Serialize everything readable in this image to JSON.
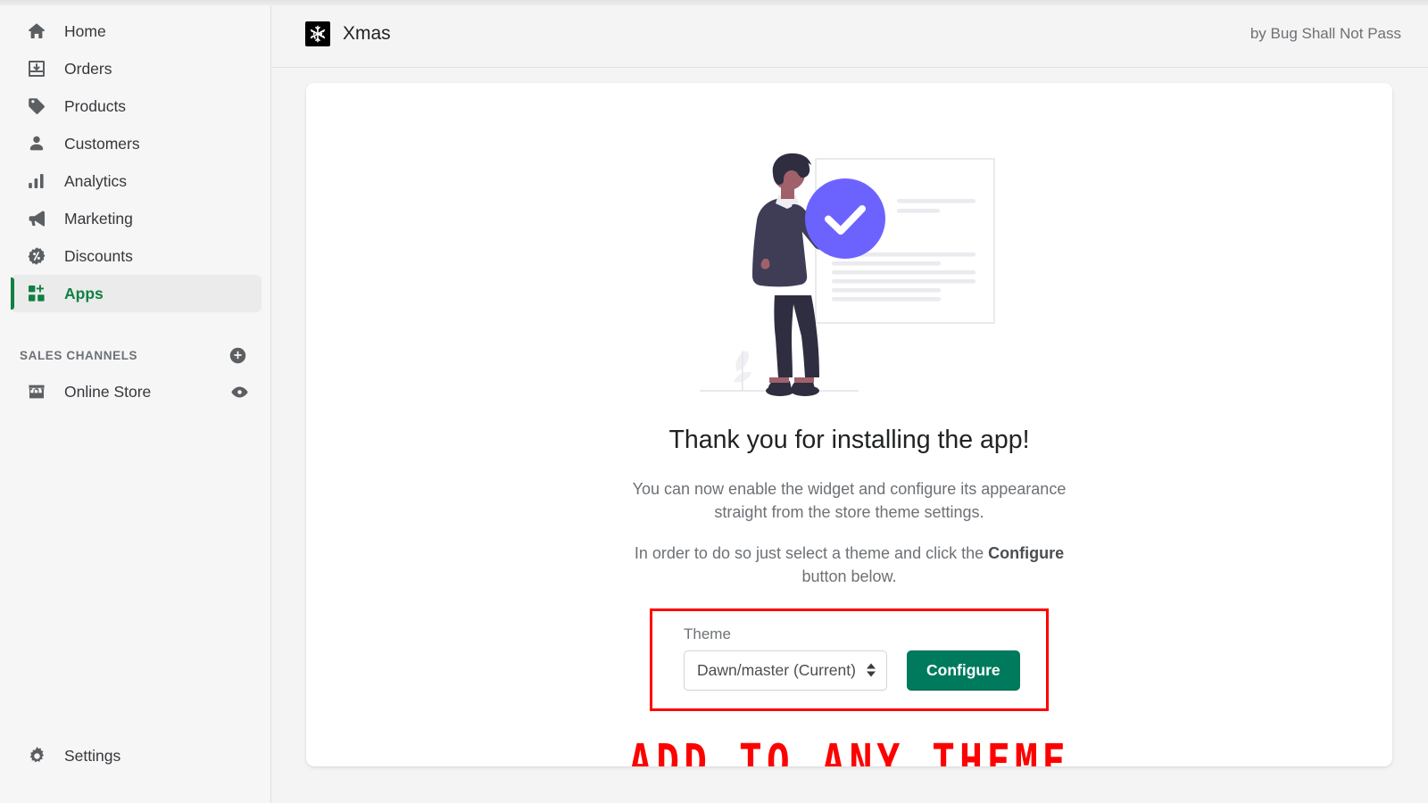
{
  "sidebar": {
    "nav_items": [
      {
        "label": "Home",
        "icon": "home-icon"
      },
      {
        "label": "Orders",
        "icon": "orders-inbox-icon"
      },
      {
        "label": "Products",
        "icon": "tag-icon"
      },
      {
        "label": "Customers",
        "icon": "person-icon"
      },
      {
        "label": "Analytics",
        "icon": "bar-chart-icon"
      },
      {
        "label": "Marketing",
        "icon": "megaphone-icon"
      },
      {
        "label": "Discounts",
        "icon": "percent-badge-icon"
      },
      {
        "label": "Apps",
        "icon": "apps-grid-plus-icon",
        "active": true
      }
    ],
    "section": {
      "label": "SALES CHANNELS",
      "add_icon": "plus-circle-icon"
    },
    "channels": [
      {
        "label": "Online Store",
        "icon": "storefront-icon",
        "action_icon": "eye-icon"
      }
    ],
    "settings": {
      "label": "Settings",
      "icon": "gear-icon"
    },
    "active_color": "#108043"
  },
  "header": {
    "app_icon": "snowflake-icon",
    "title": "Xmas",
    "author": "by Bug Shall Not Pass"
  },
  "main": {
    "illustration": "person-checklist-illustration",
    "headline": "Thank you for installing the app!",
    "paragraph_1": "You can now enable the widget and configure its appearance straight from the store theme settings.",
    "paragraph_2_before": "In order to do so just select a theme and click the ",
    "paragraph_2_bold": "Configure",
    "paragraph_2_after": " button below.",
    "theme_field": {
      "label": "Theme",
      "selected_value": "Dawn/master (Current)",
      "caret_icon": "chevron-up-down-icon"
    },
    "configure_button": "Configure",
    "annotation_banner": "ADD TO ANY THEME",
    "annotation_color": "#ff0000",
    "button_color": "#007a5c"
  }
}
